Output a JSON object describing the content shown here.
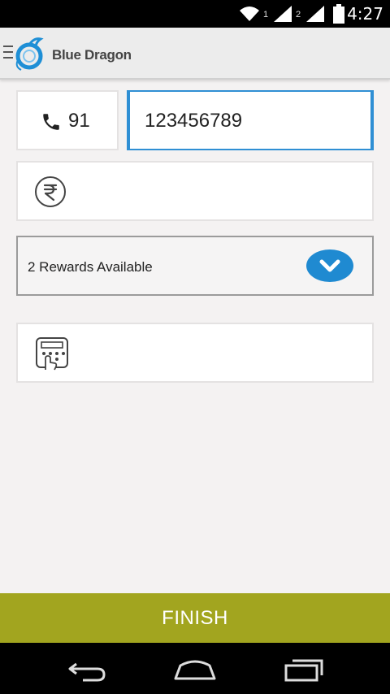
{
  "status_bar": {
    "time": "4:27",
    "sim1": "1",
    "sim2": "2",
    "icons": [
      "wifi-icon",
      "signal-icon",
      "signal-icon",
      "battery-icon"
    ]
  },
  "app_bar": {
    "title": "Blue Dragon",
    "icons": [
      "menu-icon",
      "dragon-logo-icon"
    ]
  },
  "form": {
    "country_code": "91",
    "phone_number": "123456789",
    "amount_value": "",
    "rewards_label": "2 Rewards Available",
    "code_value": "",
    "icons": [
      "phone-icon",
      "rupee-icon",
      "chevron-down-icon",
      "keypad-icon"
    ]
  },
  "finish": {
    "label": "FINISH"
  },
  "nav": {
    "icons": [
      "back-icon",
      "home-icon",
      "recents-icon"
    ]
  },
  "colors": {
    "accent_blue": "#2f8fd4",
    "finish_green": "#a2a51f",
    "background": "#f4f2f2"
  }
}
